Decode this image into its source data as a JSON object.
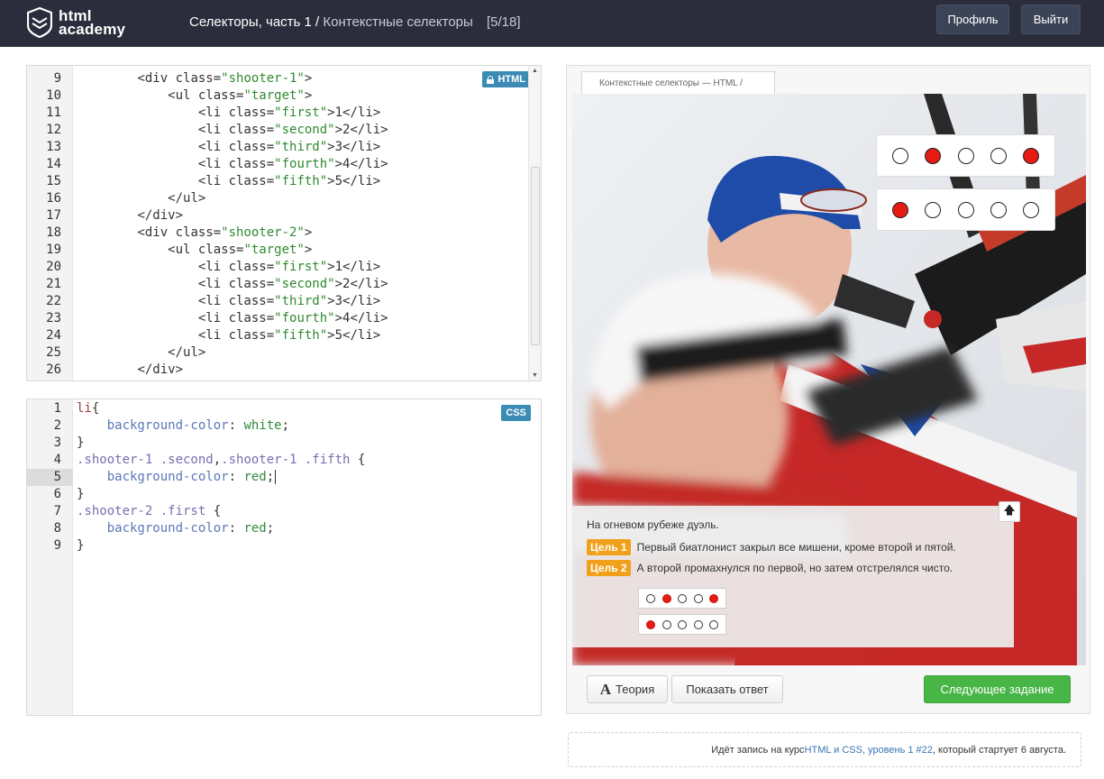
{
  "header": {
    "logo_line1": "html",
    "logo_line2": "academy",
    "breadcrumb_main": "Селекторы, часть 1 /",
    "breadcrumb_sub": "Контекстные селекторы",
    "counter": "[5/18]",
    "profile_label": "Профиль",
    "logout_label": "Выйти"
  },
  "html_editor": {
    "badge": "HTML",
    "lines": [
      {
        "n": "9",
        "indent": "        ",
        "parts": [
          [
            "t",
            "<div "
          ],
          [
            "a",
            "class="
          ],
          [
            "s",
            "\"shooter-1\""
          ],
          [
            "t",
            ">"
          ]
        ]
      },
      {
        "n": "10",
        "indent": "            ",
        "parts": [
          [
            "t",
            "<ul "
          ],
          [
            "a",
            "class="
          ],
          [
            "s",
            "\"target\""
          ],
          [
            "t",
            ">"
          ]
        ]
      },
      {
        "n": "11",
        "indent": "                ",
        "parts": [
          [
            "t",
            "<li "
          ],
          [
            "a",
            "class="
          ],
          [
            "s",
            "\"first\""
          ],
          [
            "t",
            ">1</li>"
          ]
        ]
      },
      {
        "n": "12",
        "indent": "                ",
        "parts": [
          [
            "t",
            "<li "
          ],
          [
            "a",
            "class="
          ],
          [
            "s",
            "\"second\""
          ],
          [
            "t",
            ">2</li>"
          ]
        ]
      },
      {
        "n": "13",
        "indent": "                ",
        "parts": [
          [
            "t",
            "<li "
          ],
          [
            "a",
            "class="
          ],
          [
            "s",
            "\"third\""
          ],
          [
            "t",
            ">3</li>"
          ]
        ]
      },
      {
        "n": "14",
        "indent": "                ",
        "parts": [
          [
            "t",
            "<li "
          ],
          [
            "a",
            "class="
          ],
          [
            "s",
            "\"fourth\""
          ],
          [
            "t",
            ">4</li>"
          ]
        ]
      },
      {
        "n": "15",
        "indent": "                ",
        "parts": [
          [
            "t",
            "<li "
          ],
          [
            "a",
            "class="
          ],
          [
            "s",
            "\"fifth\""
          ],
          [
            "t",
            ">5</li>"
          ]
        ]
      },
      {
        "n": "16",
        "indent": "            ",
        "parts": [
          [
            "t",
            "</ul>"
          ]
        ]
      },
      {
        "n": "17",
        "indent": "        ",
        "parts": [
          [
            "t",
            "</div>"
          ]
        ]
      },
      {
        "n": "18",
        "indent": "        ",
        "parts": [
          [
            "t",
            "<div "
          ],
          [
            "a",
            "class="
          ],
          [
            "s",
            "\"shooter-2\""
          ],
          [
            "t",
            ">"
          ]
        ]
      },
      {
        "n": "19",
        "indent": "            ",
        "parts": [
          [
            "t",
            "<ul "
          ],
          [
            "a",
            "class="
          ],
          [
            "s",
            "\"target\""
          ],
          [
            "t",
            ">"
          ]
        ]
      },
      {
        "n": "20",
        "indent": "                ",
        "parts": [
          [
            "t",
            "<li "
          ],
          [
            "a",
            "class="
          ],
          [
            "s",
            "\"first\""
          ],
          [
            "t",
            ">1</li>"
          ]
        ]
      },
      {
        "n": "21",
        "indent": "                ",
        "parts": [
          [
            "t",
            "<li "
          ],
          [
            "a",
            "class="
          ],
          [
            "s",
            "\"second\""
          ],
          [
            "t",
            ">2</li>"
          ]
        ]
      },
      {
        "n": "22",
        "indent": "                ",
        "parts": [
          [
            "t",
            "<li "
          ],
          [
            "a",
            "class="
          ],
          [
            "s",
            "\"third\""
          ],
          [
            "t",
            ">3</li>"
          ]
        ]
      },
      {
        "n": "23",
        "indent": "                ",
        "parts": [
          [
            "t",
            "<li "
          ],
          [
            "a",
            "class="
          ],
          [
            "s",
            "\"fourth\""
          ],
          [
            "t",
            ">4</li>"
          ]
        ]
      },
      {
        "n": "24",
        "indent": "                ",
        "parts": [
          [
            "t",
            "<li "
          ],
          [
            "a",
            "class="
          ],
          [
            "s",
            "\"fifth\""
          ],
          [
            "t",
            ">5</li>"
          ]
        ]
      },
      {
        "n": "25",
        "indent": "            ",
        "parts": [
          [
            "t",
            "</ul>"
          ]
        ]
      },
      {
        "n": "26",
        "indent": "        ",
        "parts": [
          [
            "t",
            "</div>"
          ]
        ]
      }
    ]
  },
  "css_editor": {
    "badge": "CSS",
    "lines": [
      {
        "n": "1",
        "indent": "",
        "parts": [
          [
            "tag",
            "li"
          ],
          [
            "p",
            "{"
          ]
        ]
      },
      {
        "n": "2",
        "indent": "    ",
        "parts": [
          [
            "prop",
            "background-color"
          ],
          [
            "p",
            ": "
          ],
          [
            "val",
            "white"
          ],
          [
            "p",
            ";"
          ]
        ]
      },
      {
        "n": "3",
        "indent": "",
        "parts": [
          [
            "p",
            "}"
          ]
        ]
      },
      {
        "n": "4",
        "indent": "",
        "parts": [
          [
            "sel",
            ".shooter-1 .second"
          ],
          [
            "p",
            ","
          ],
          [
            "sel",
            ".shooter-1 .fifth"
          ],
          [
            "p",
            " {"
          ]
        ]
      },
      {
        "n": "5",
        "indent": "    ",
        "parts": [
          [
            "prop",
            "background-color"
          ],
          [
            "p",
            ": "
          ],
          [
            "val",
            "red"
          ],
          [
            "p",
            ";"
          ]
        ],
        "active": true
      },
      {
        "n": "6",
        "indent": "",
        "parts": [
          [
            "p",
            "}"
          ]
        ]
      },
      {
        "n": "7",
        "indent": "",
        "parts": [
          [
            "sel",
            ".shooter-2 .first"
          ],
          [
            "p",
            " {"
          ]
        ]
      },
      {
        "n": "8",
        "indent": "    ",
        "parts": [
          [
            "prop",
            "background-color"
          ],
          [
            "p",
            ": "
          ],
          [
            "val",
            "red"
          ],
          [
            "p",
            ";"
          ]
        ]
      },
      {
        "n": "9",
        "indent": "",
        "parts": [
          [
            "p",
            "}"
          ]
        ]
      }
    ]
  },
  "preview": {
    "tab_title": "Контекстные селекторы — HTML /",
    "shooter1_targets": [
      "white",
      "red",
      "white",
      "white",
      "red"
    ],
    "shooter2_targets": [
      "red",
      "white",
      "white",
      "white",
      "white"
    ],
    "task_intro": "На огневом рубеже дуэль.",
    "goal1_tag": "Цель 1",
    "goal1_text": "Первый биатлонист закрыл все мишени, кроме второй и пятой.",
    "goal2_tag": "Цель 2",
    "goal2_text": "А второй промахнулся по первой, но затем отстрелялся чисто.",
    "mini1": [
      "white",
      "red",
      "white",
      "white",
      "red"
    ],
    "mini2": [
      "red",
      "white",
      "white",
      "white",
      "white"
    ],
    "theory_icon": "A",
    "theory_label": "Теория",
    "answer_label": "Показать ответ",
    "next_label": "Следующее задание"
  },
  "note": {
    "prefix": "Идёт запись на курс ",
    "course_link": "HTML и CSS, уровень 1 #22",
    "suffix": ", который стартует 6 августа."
  },
  "colors": {
    "header_bg": "#2b2d3c",
    "badge_blue": "#3b8bb5",
    "goal_orange": "#f0a01b",
    "next_green": "#48b547",
    "target_red": "#e51b14"
  }
}
